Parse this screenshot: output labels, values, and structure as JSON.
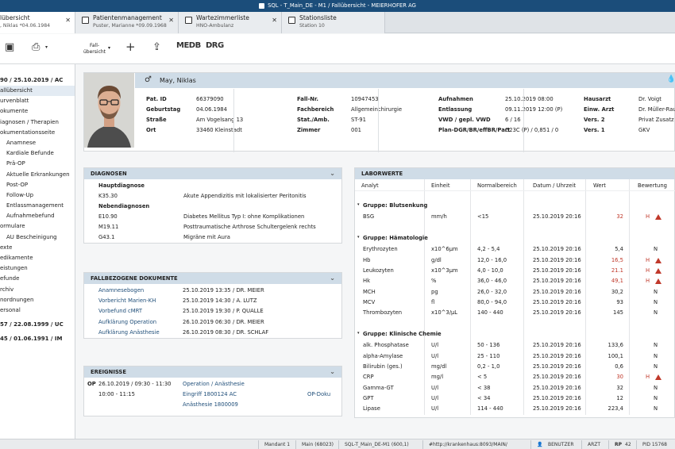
{
  "window": {
    "title": "SQL - T_Main_DE - M1 / Fallübersicht - MEIERHOFER AG"
  },
  "tabs": [
    {
      "line1": "lübersicht",
      "line2": ", Niklas *04.06.1984",
      "active": true
    },
    {
      "line1": "Patientenmanagement",
      "line2": "Puster, Marianne *09.09.1968",
      "active": false
    },
    {
      "line1": "Wartezimmerliste",
      "line2": "HNO-Ambulanz",
      "active": false
    },
    {
      "line1": "Stationsliste",
      "line2": "Station 10",
      "active": false
    }
  ],
  "toolbar": {
    "fall_line1": "Fall-",
    "fall_line2": "übersicht",
    "medb": "MEDB",
    "drg": "DRG"
  },
  "sidebar": {
    "header1": "90 / 25.10.2019 / AC",
    "items": [
      {
        "label": "allübersicht",
        "active": true,
        "level": 0
      },
      {
        "label": "urvenblatt",
        "level": 0
      },
      {
        "label": "okumente",
        "level": 0
      },
      {
        "label": "iagnosen / Therapien",
        "level": 0
      },
      {
        "label": "okumentationsseite",
        "level": 0
      },
      {
        "label": "Anamnese",
        "level": 1
      },
      {
        "label": "Kardiale Befunde",
        "level": 1
      },
      {
        "label": "Prä-OP",
        "level": 1
      },
      {
        "label": "Aktuelle Erkrankungen",
        "level": 1
      },
      {
        "label": "Post-OP",
        "level": 1
      },
      {
        "label": "Follow-Up",
        "level": 1
      },
      {
        "label": "Entlassmanagement",
        "level": 1
      },
      {
        "label": "Aufnahmebefund",
        "level": 1
      },
      {
        "label": "ormulare",
        "level": 0
      },
      {
        "label": "AU Bescheinigung",
        "level": 1
      },
      {
        "label": "exte",
        "level": 0
      },
      {
        "label": "edikamente",
        "level": 0
      },
      {
        "label": "eistungen",
        "level": 0
      },
      {
        "label": "efunde",
        "level": 0
      },
      {
        "label": "rchiv",
        "level": 0
      },
      {
        "label": "nordnungen",
        "level": 0
      },
      {
        "label": "ersonal",
        "level": 0
      }
    ],
    "header2": "57 / 22.08.1999 / UC",
    "header3": "45 / 01.06.1991 / IM"
  },
  "patient": {
    "name": "May, Niklas",
    "col1": [
      [
        "Pat. ID",
        "66379090"
      ],
      [
        "Geburtstag",
        "04.06.1984"
      ],
      [
        "Straße",
        "Am Vogelsang 13"
      ],
      [
        "Ort",
        "33460 Kleinstadt"
      ]
    ],
    "col2": [
      [
        "Fall-Nr.",
        "10947453"
      ],
      [
        "Fachbereich",
        "Allgemeinchirurgie"
      ],
      [
        "Stat./Amb.",
        "ST-91"
      ],
      [
        "Zimmer",
        "001"
      ]
    ],
    "col3": [
      [
        "Aufnahmen",
        "25.10.2019 08:00"
      ],
      [
        "Entlassung",
        "09.11.2019 12:00 (P)"
      ],
      [
        "VWD / gepl. VWD",
        "6 / 16"
      ],
      [
        "Plan-DGR/BR/effBR/Part",
        "G23C (P) / 0,851 / 0"
      ]
    ],
    "col4": [
      [
        "Hausarzt",
        "Dr. Voigt"
      ],
      [
        "Einw. Arzt",
        "Dr. Müller-Raul"
      ],
      [
        "Vers. 2",
        "Privat Zusatz"
      ],
      [
        "Vers. 1",
        "GKV"
      ]
    ]
  },
  "diagnosen": {
    "title": "DIAGNOSEN",
    "haupt_label": "Hauptdiagnose",
    "haupt": [
      [
        "K35.30",
        "Akute Appendizitis mit lokalisierter Peritonitis"
      ]
    ],
    "neben_label": "Nebendiagnosen",
    "neben": [
      [
        "E10.90",
        "Diabetes Mellitus Typ I: ohne Komplikationen"
      ],
      [
        "M19.11",
        "Posttraumatische Arthrose Schultergelenk rechts"
      ],
      [
        "G43.1",
        "Migräne mit Aura"
      ]
    ]
  },
  "dokumente": {
    "title": "FALLBEZOGENE DOKUMENTE",
    "rows": [
      [
        "Anamnesebogen",
        "25.10.2019",
        "13:35",
        "/ DR. MEIER"
      ],
      [
        "Vorbericht Marien-KH",
        "25.10.2019",
        "14:30",
        "/ A. LUTZ"
      ],
      [
        "Vorbefund cMRT",
        "25.10.2019",
        "19:30",
        "/ P. QUALLE"
      ],
      [
        "Aufklärung Operation",
        "26.10.2019",
        "06:30",
        "/ DR. MEIER"
      ],
      [
        "Aufklärung Anästhesie",
        "26.10.2019",
        "08:30",
        "/ DR. SCHLAF"
      ]
    ]
  },
  "ereignisse": {
    "title": "EREIGNISSE",
    "rows": [
      {
        "tag": "OP",
        "time": "26.10.2019 / 09:30 - 11:30",
        "link": "Operation / Anästhesie",
        "extra": ""
      },
      {
        "tag": "",
        "time": "10:00 - 11:15",
        "link": "Eingriff 1800124 AC",
        "extra": "OP-Doku"
      },
      {
        "tag": "",
        "time": "",
        "link": "Anästhesie 1800009",
        "extra": ""
      }
    ]
  },
  "labor": {
    "title": "LABORWERTE",
    "columns": [
      "Analyt",
      "Einheit",
      "Normalbereich",
      "Datum / Uhrzeit",
      "Wert",
      "Bewertung"
    ],
    "groups": [
      {
        "name": "Gruppe: Blutsenkung",
        "rows": [
          {
            "a": "BSG",
            "u": "mm/h",
            "n": "<15",
            "d": "25.10.2019  20:16",
            "w": "32",
            "b": "H",
            "flag": true
          }
        ]
      },
      {
        "name": "Gruppe: Hämatologie",
        "rows": [
          {
            "a": "Erythrozyten",
            "u": "x10^6μm",
            "n": "4,2 - 5,4",
            "d": "25.10.2019  20:16",
            "w": "5,4",
            "b": "N",
            "flag": false
          },
          {
            "a": "Hb",
            "u": "g/dl",
            "n": "12,0 - 16,0",
            "d": "25.10.2019  20:16",
            "w": "16,5",
            "b": "H",
            "flag": true
          },
          {
            "a": "Leukozyten",
            "u": "x10^3μm",
            "n": "4,0 - 10,0",
            "d": "25.10.2019  20:16",
            "w": "21.1",
            "b": "H",
            "flag": true
          },
          {
            "a": "Hk",
            "u": "%",
            "n": "36,0 - 46,0",
            "d": "25.10.2019  20:16",
            "w": "49,1",
            "b": "H",
            "flag": true
          },
          {
            "a": "MCH",
            "u": "pg",
            "n": "26,0 - 32,0",
            "d": "25.10.2019  20:16",
            "w": "30,2",
            "b": "N",
            "flag": false
          },
          {
            "a": "MCV",
            "u": "fl",
            "n": "80,0 - 94,0",
            "d": "25.10.2019  20:16",
            "w": "93",
            "b": "N",
            "flag": false
          },
          {
            "a": "Thrombozyten",
            "u": "x10^3/μL",
            "n": "140 - 440",
            "d": "25.10.2019  20:16",
            "w": "145",
            "b": "N",
            "flag": false
          }
        ]
      },
      {
        "name": "Gruppe: Klinische Chemie",
        "rows": [
          {
            "a": "alk. Phosphatase",
            "u": "U/l",
            "n": "50 - 136",
            "d": "25.10.2019  20:16",
            "w": "133,6",
            "b": "N",
            "flag": false
          },
          {
            "a": "alpha-Amylase",
            "u": "U/l",
            "n": "25 - 110",
            "d": "25.10.2019  20:16",
            "w": "100,1",
            "b": "N",
            "flag": false
          },
          {
            "a": "Bilirubin (ges.)",
            "u": "mg/dl",
            "n": "0,2 - 1,0",
            "d": "25.10.2019  20:16",
            "w": "0,6",
            "b": "N",
            "flag": false
          },
          {
            "a": "CRP",
            "u": "mg/l",
            "n": "< 5",
            "d": "25.10.2019  20:16",
            "w": "30",
            "b": "H",
            "flag": true
          },
          {
            "a": "Gamma-GT",
            "u": "U/l",
            "n": "< 38",
            "d": "25.10.2019  20:16",
            "w": "32",
            "b": "N",
            "flag": false
          },
          {
            "a": "GPT",
            "u": "U/l",
            "n": "< 34",
            "d": "25.10.2019  20:16",
            "w": "12",
            "b": "N",
            "flag": false
          },
          {
            "a": "Lipase",
            "u": "U/l",
            "n": "114 - 440",
            "d": "25.10.2019  20:16",
            "w": "223,4",
            "b": "N",
            "flag": false
          }
        ]
      }
    ]
  },
  "statusbar": {
    "mandant": "Mandant 1",
    "main": "Main (68023)",
    "db": "SQL-T_Main_DE-M1 (600,1)",
    "url": "#http://krankenhaus:8093/MAIN/",
    "user": "BENUTZER",
    "role": "ARZT",
    "rp_label": "RP",
    "rp_value": "42",
    "pid": "PID 15768"
  },
  "colors": {
    "accent": "#1b4d7a",
    "panel_header": "#cfdce7",
    "link": "#1f4e79",
    "alert": "#c0392b"
  }
}
